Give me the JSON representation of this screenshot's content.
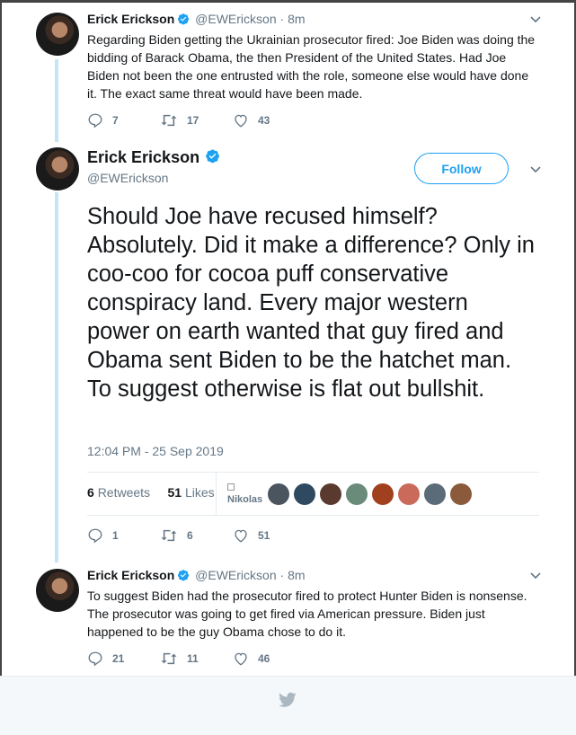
{
  "colors": {
    "accent": "#1da1f2",
    "secondary_text": "#657786",
    "thread": "#c4e5f8"
  },
  "tweet1": {
    "name": "Erick Erickson",
    "handle": "@EWErickson",
    "dot": "·",
    "time": "8m",
    "text": "Regarding Biden getting the Ukrainian prosecutor fired: Joe Biden was doing the bidding of Barack Obama, the then President of the United States. Had Joe Biden not been the one entrusted with the role, someone else would have done it. The exact same threat would have been made.",
    "replies": "7",
    "retweets": "17",
    "likes": "43"
  },
  "main": {
    "name": "Erick Erickson",
    "handle": "@EWErickson",
    "follow_label": "Follow",
    "text": "Should Joe have recused himself? Absolutely. Did it make a difference? Only in coo-coo for cocoa puff conservative conspiracy land. Every major western power on earth wanted that guy fired and Obama sent Biden to be the hatchet man. To suggest otherwise is flat out bullshit.",
    "timestamp": "12:04 PM - 25 Sep 2019",
    "retweet_count": "6",
    "retweet_label": "Retweets",
    "like_count": "51",
    "like_label": "Likes",
    "liker_alt": "Nikolas",
    "replies": "1",
    "retweets": "6",
    "likes": "51"
  },
  "tweet3": {
    "name": "Erick Erickson",
    "handle": "@EWErickson",
    "dot": "·",
    "time": "8m",
    "text": "To suggest Biden had the prosecutor fired to protect Hunter Biden is nonsense. The prosecutor was going to get fired via American pressure.  Biden just happened to be the guy Obama chose to do it.",
    "replies": "21",
    "retweets": "11",
    "likes": "46"
  },
  "icons": [
    "verified-icon",
    "chevron-down-icon",
    "reply-icon",
    "retweet-icon",
    "heart-icon",
    "twitter-bird-icon"
  ]
}
